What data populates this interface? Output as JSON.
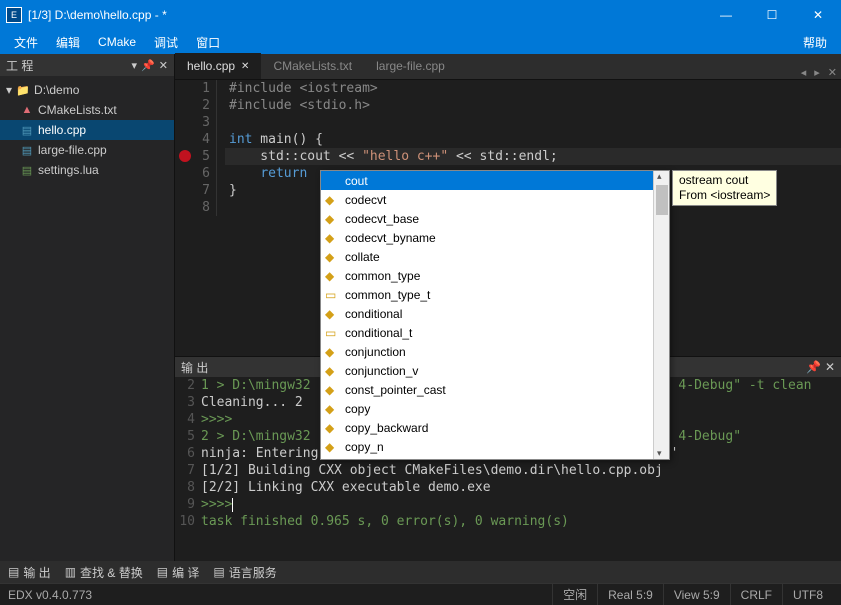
{
  "title": "[1/3] D:\\demo\\hello.cpp - *",
  "menu": {
    "file": "文件",
    "edit": "编辑",
    "cmake": "CMake",
    "debug": "调试",
    "window": "窗口",
    "help": "帮助"
  },
  "sidebar": {
    "title": "工 程",
    "root": "D:\\demo",
    "items": [
      {
        "label": "CMakeLists.txt"
      },
      {
        "label": "hello.cpp"
      },
      {
        "label": "large-file.cpp"
      },
      {
        "label": "settings.lua"
      }
    ]
  },
  "tabs": [
    {
      "label": "hello.cpp",
      "active": true,
      "dirty": true
    },
    {
      "label": "CMakeLists.txt",
      "active": false
    },
    {
      "label": "large-file.cpp",
      "active": false
    }
  ],
  "code": {
    "lines": [
      "#include <iostream>",
      "#include <stdio.h>",
      "",
      "int main() {",
      "    std::cout << \"hello c++\" << std::endl;",
      "    return ",
      "}",
      ""
    ],
    "breakpoint_line": 5,
    "highlight_line": 5
  },
  "autocomplete": {
    "items": [
      {
        "label": "cout",
        "icon": "blue",
        "sel": true
      },
      {
        "label": "codecvt",
        "icon": "diamond"
      },
      {
        "label": "codecvt_base",
        "icon": "diamond"
      },
      {
        "label": "codecvt_byname",
        "icon": "diamond"
      },
      {
        "label": "collate",
        "icon": "diamond"
      },
      {
        "label": "common_type",
        "icon": "diamond"
      },
      {
        "label": "common_type_t",
        "icon": "box"
      },
      {
        "label": "conditional",
        "icon": "diamond"
      },
      {
        "label": "conditional_t",
        "icon": "box"
      },
      {
        "label": "conjunction",
        "icon": "diamond"
      },
      {
        "label": "conjunction_v",
        "icon": "diamond"
      },
      {
        "label": "const_pointer_cast",
        "icon": "diamond"
      },
      {
        "label": "copy",
        "icon": "diamond"
      },
      {
        "label": "copy_backward",
        "icon": "diamond"
      },
      {
        "label": "copy_n",
        "icon": "diamond"
      }
    ],
    "hint_line1": "ostream cout",
    "hint_line2": "From <iostream>"
  },
  "output": {
    "title": "输 出",
    "lines": [
      {
        "n": 2,
        "t": "1 > D:\\mingw32                                               4-Debug\" -t clean",
        "cls": "grn"
      },
      {
        "n": 3,
        "t": "Cleaning... 2",
        "cls": ""
      },
      {
        "n": 4,
        "t": ">>>>",
        "cls": "grn"
      },
      {
        "n": 5,
        "t": "2 > D:\\mingw32                                               4-Debug\"",
        "cls": "grn"
      },
      {
        "n": 6,
        "t": "ninja: Entering directory `D:/demo/.cmake-build-vc-x64-Debug'",
        "cls": ""
      },
      {
        "n": 7,
        "t": "[1/2] Building CXX object CMakeFiles\\demo.dir\\hello.cpp.obj",
        "cls": ""
      },
      {
        "n": 8,
        "t": "[2/2] Linking CXX executable demo.exe",
        "cls": ""
      },
      {
        "n": 9,
        "t": ">>>>",
        "cls": "grn",
        "caret": true
      },
      {
        "n": 10,
        "t": "task finished 0.965 s, 0 error(s), 0 warning(s)",
        "cls": "grn"
      }
    ]
  },
  "bottom": {
    "output": "输 出",
    "search": "查找 & 替换",
    "compile": "编 译",
    "lang": "语言服务"
  },
  "status": {
    "version": "EDX v0.4.0.773",
    "space": "空闲",
    "real": "Real 5:9",
    "view": "View 5:9",
    "crlf": "CRLF",
    "enc": "UTF8"
  }
}
